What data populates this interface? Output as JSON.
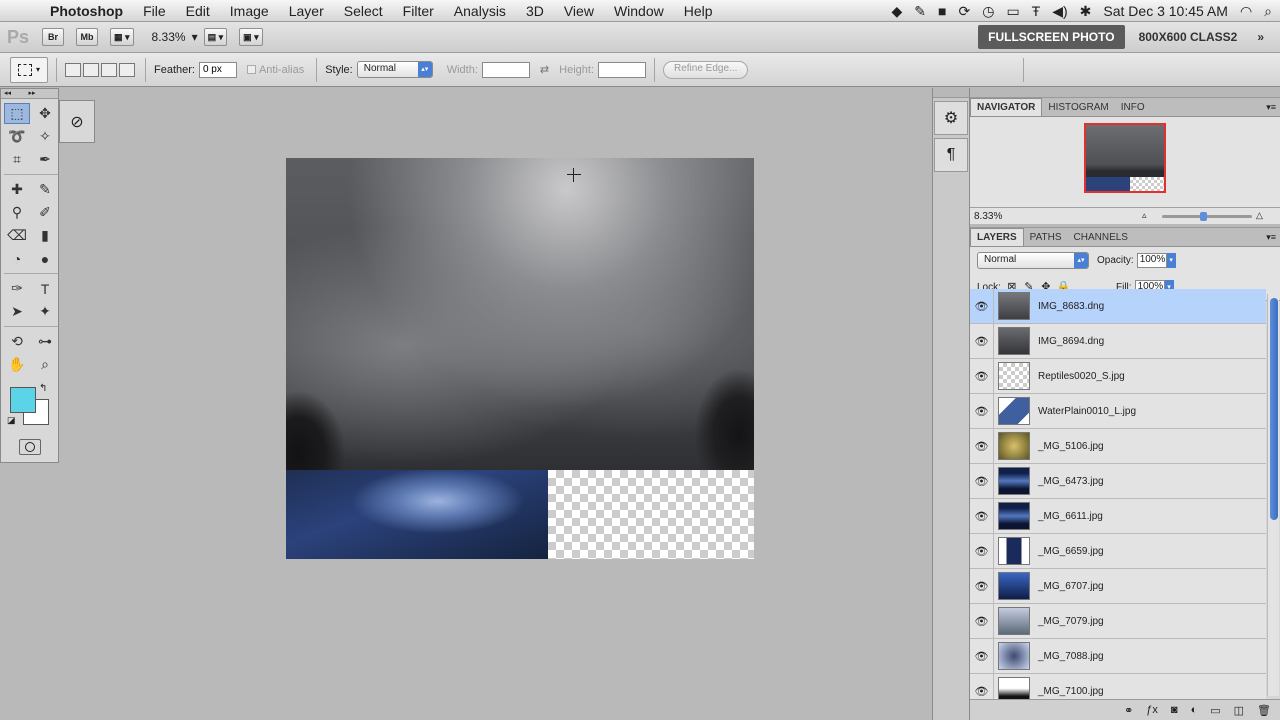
{
  "menubar": {
    "app": "Photoshop",
    "items": [
      "File",
      "Edit",
      "Image",
      "Layer",
      "Select",
      "Filter",
      "Analysis",
      "3D",
      "View",
      "Window",
      "Help"
    ],
    "clock": "Sat Dec 3  10:45 AM"
  },
  "appbar": {
    "logo": "Ps",
    "bridge": "Br",
    "minibridge": "Mb",
    "zoom": "8.33%",
    "workspace_active": "FULLSCREEN PHOTO",
    "workspace_other": "800X600 CLASS2"
  },
  "options": {
    "feather_label": "Feather:",
    "feather_value": "0 px",
    "antialias_label": "Anti-alias",
    "style_label": "Style:",
    "style_value": "Normal",
    "width_label": "Width:",
    "height_label": "Height:",
    "refine_label": "Refine Edge..."
  },
  "colors": {
    "foreground": "#5cd3e6",
    "background": "#ffffff"
  },
  "navigator": {
    "tabs": [
      "NAVIGATOR",
      "HISTOGRAM",
      "INFO"
    ],
    "zoom": "8.33%"
  },
  "layers_panel": {
    "tabs": [
      "LAYERS",
      "PATHS",
      "CHANNELS"
    ],
    "blend_mode": "Normal",
    "opacity_label": "Opacity:",
    "opacity": "100%",
    "lock_label": "Lock:",
    "fill_label": "Fill:",
    "fill": "100%",
    "layers": [
      {
        "name": "IMG_8683.dng",
        "thumb": "t-sky",
        "selected": true
      },
      {
        "name": "IMG_8694.dng",
        "thumb": "t-sky2",
        "selected": false
      },
      {
        "name": "Reptiles0020_S.jpg",
        "thumb": "t-chk",
        "selected": false
      },
      {
        "name": "WaterPlain0010_L.jpg",
        "thumb": "t-water",
        "selected": false
      },
      {
        "name": "_MG_5106.jpg",
        "thumb": "t-yellow",
        "selected": false
      },
      {
        "name": "_MG_6473.jpg",
        "thumb": "t-blue",
        "selected": false
      },
      {
        "name": "_MG_6611.jpg",
        "thumb": "t-blue",
        "selected": false
      },
      {
        "name": "_MG_6659.jpg",
        "thumb": "t-blue2",
        "selected": false
      },
      {
        "name": "_MG_6707.jpg",
        "thumb": "t-blue3",
        "selected": false
      },
      {
        "name": "_MG_7079.jpg",
        "thumb": "t-grey",
        "selected": false
      },
      {
        "name": "_MG_7088.jpg",
        "thumb": "t-tree",
        "selected": false
      },
      {
        "name": "_MG_7100.jpg",
        "thumb": "t-black",
        "selected": false
      }
    ]
  }
}
